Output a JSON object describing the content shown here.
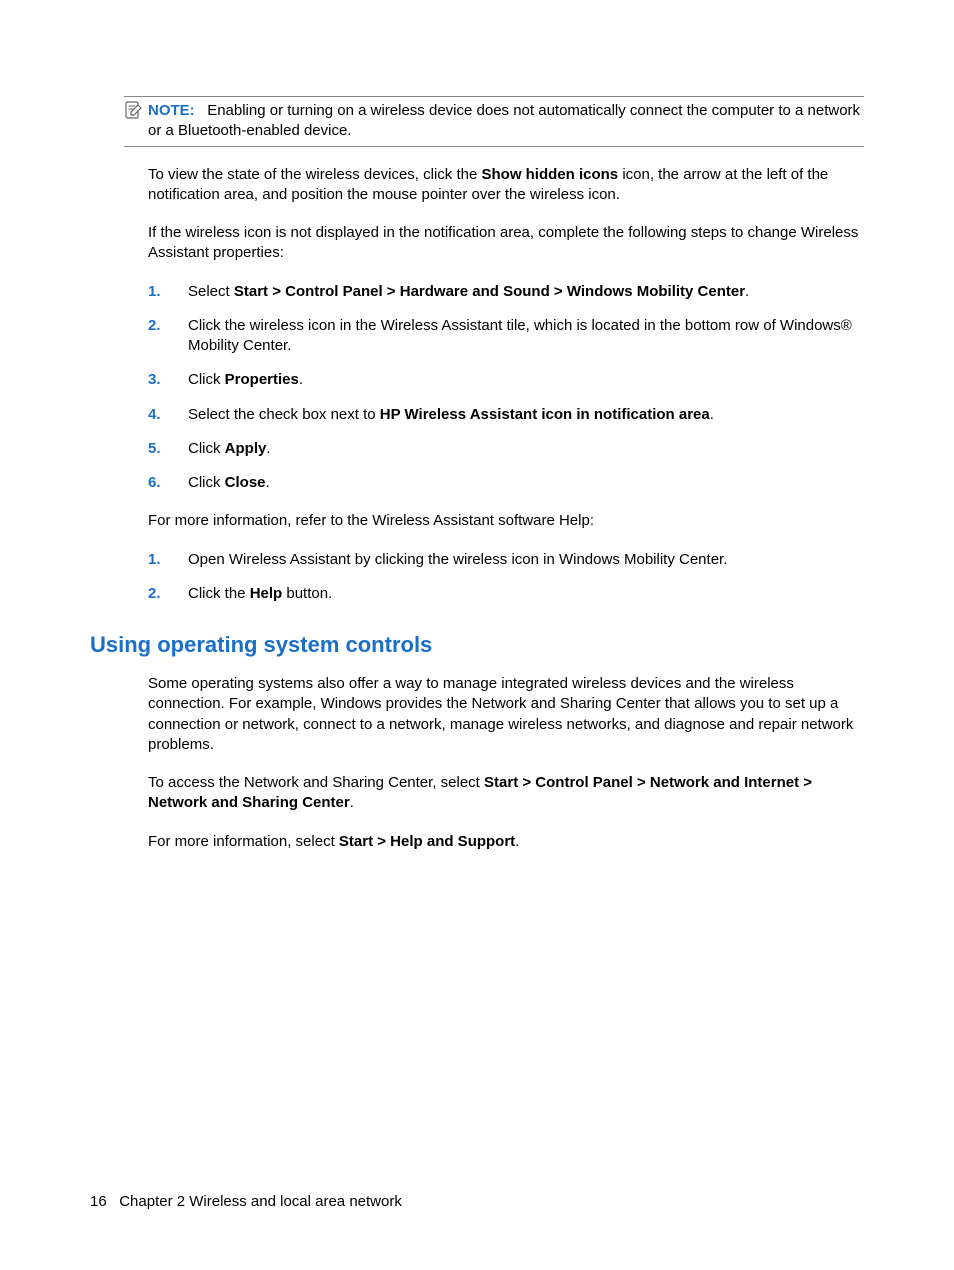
{
  "note": {
    "label": "NOTE:",
    "text": "Enabling or turning on a wireless device does not automatically connect the computer to a network or a Bluetooth-enabled device."
  },
  "para_view_pre": "To view the state of the wireless devices, click the ",
  "para_view_bold": "Show hidden icons",
  "para_view_post": " icon, the arrow at the left of the notification area, and position the mouse pointer over the wireless icon.",
  "para_notdisplayed": "If the wireless icon is not displayed in the notification area, complete the following steps to change Wireless Assistant properties:",
  "stepsA": {
    "n1": "1.",
    "t1_pre": "Select ",
    "t1_bold": "Start > Control Panel > Hardware and Sound > Windows Mobility Center",
    "t1_post": ".",
    "n2": "2.",
    "t2": "Click the wireless icon in the Wireless Assistant tile, which is located in the bottom row of Windows® Mobility Center.",
    "n3": "3.",
    "t3_pre": "Click ",
    "t3_bold": "Properties",
    "t3_post": ".",
    "n4": "4.",
    "t4_pre": "Select the check box next to ",
    "t4_bold": "HP Wireless Assistant icon in notification area",
    "t4_post": ".",
    "n5": "5.",
    "t5_pre": "Click ",
    "t5_bold": "Apply",
    "t5_post": ".",
    "n6": "6.",
    "t6_pre": "Click ",
    "t6_bold": "Close",
    "t6_post": "."
  },
  "para_more": "For more information, refer to the Wireless Assistant software Help:",
  "stepsB": {
    "n1": "1.",
    "t1": "Open Wireless Assistant by clicking the wireless icon in Windows Mobility Center.",
    "n2": "2.",
    "t2_pre": "Click the ",
    "t2_bold": "Help",
    "t2_post": " button."
  },
  "section_heading": "Using operating system controls",
  "os_para1": "Some operating systems also offer a way to manage integrated wireless devices and the wireless connection. For example, Windows provides the Network and Sharing Center that allows you to set up a connection or network, connect to a network, manage wireless networks, and diagnose and repair network problems.",
  "os_para2_pre": "To access the Network and Sharing Center, select ",
  "os_para2_bold": "Start > Control Panel > Network and Internet > Network and Sharing Center",
  "os_para2_post": ".",
  "os_para3_pre": "For more information, select ",
  "os_para3_bold": "Start > Help and Support",
  "os_para3_post": ".",
  "footer": {
    "page": "16",
    "chapter": "Chapter 2   Wireless and local area network"
  }
}
